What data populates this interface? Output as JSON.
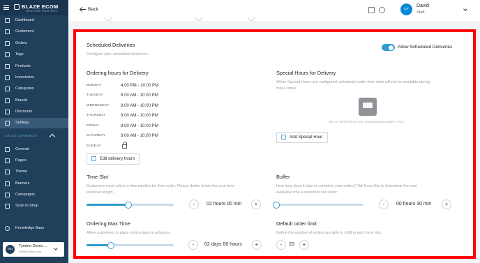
{
  "brand": {
    "name": "BLAZE ECOM",
    "tagline": "MISSION CONTROL"
  },
  "sidebar": {
    "items": [
      {
        "label": "Dashboard",
        "icon": "dashboard-icon"
      },
      {
        "label": "Customers",
        "icon": "customers-icon"
      },
      {
        "label": "Orders",
        "icon": "orders-icon"
      },
      {
        "label": "Tags",
        "icon": "tags-icon"
      },
      {
        "label": "Products",
        "icon": "products-icon"
      },
      {
        "label": "Inventories",
        "icon": "inventories-icon"
      },
      {
        "label": "Categories",
        "icon": "categories-icon"
      },
      {
        "label": "Brands",
        "icon": "brands-icon"
      },
      {
        "label": "Discounts",
        "icon": "discounts-icon"
      },
      {
        "label": "Settings",
        "icon": "settings-icon"
      }
    ],
    "section_label": "SALES CHANNELS",
    "sales_items": [
      {
        "label": "General",
        "icon": "general-icon"
      },
      {
        "label": "Pages",
        "icon": "pages-icon"
      },
      {
        "label": "Theme",
        "icon": "theme-icon"
      },
      {
        "label": "Banners",
        "icon": "banners-icon"
      },
      {
        "label": "Campaigns",
        "icon": "campaigns-icon"
      },
      {
        "label": "Scan to Shop",
        "icon": "scan-icon"
      }
    ],
    "knowledge_base": "Knowledge Base",
    "store": {
      "avatar": "TBE1",
      "name": "Tymber Demo ...",
      "subtitle": "Delivery, Pickup, Kiosk"
    }
  },
  "header": {
    "back_label": "Back",
    "user_initials": "DT",
    "user_name": "David",
    "user_role": "Staff"
  },
  "scheduled": {
    "title": "Scheduled Deliveries",
    "description": "Configure your scheduled deliveries.",
    "toggle_label": "Allow Scheduled Deliveries",
    "toggle_on": true
  },
  "ordering_hours": {
    "title": "Ordering hours for Delivery",
    "days": [
      {
        "day": "MONDAY",
        "hours": "4:00 PM - 10:00 PM"
      },
      {
        "day": "TUESDAY",
        "hours": "8:00 AM - 10:00 PM"
      },
      {
        "day": "WEDNESDAY",
        "hours": "8:00 AM - 10:00 PM"
      },
      {
        "day": "THURSDAY",
        "hours": "8:00 AM - 10:00 PM"
      },
      {
        "day": "FRIDAY",
        "hours": "8:00 AM - 10:00 PM"
      },
      {
        "day": "SATURDAY",
        "hours": "8:00 AM - 10:00 PM"
      },
      {
        "day": "SUNDAY",
        "hours": ""
      }
    ],
    "edit_button": "Edit delivery hours"
  },
  "special_hours": {
    "title": "Special Hours for Delivery",
    "description_line1": "When Special Hours are configured, scheduled order time slots will not be available during",
    "description_line2": "those times.",
    "empty_text": "NO STORE/SPECIAL-HOURS/DELIVERY YET.",
    "add_button": "Add Special Hour"
  },
  "time_slot": {
    "title": "Time Slot",
    "description_line1": "Customers must select a time window for their order. Please define below the your time",
    "description_line2": "windows length.",
    "value": "02 hours 00 min",
    "slider_fraction": 0.48
  },
  "buffer": {
    "title": "Buffer",
    "description_line1": "How long does it take to complete your orders? We'll use this to determine the next",
    "description_line2": "available time a customer can order.",
    "value": "00 hours 30 min",
    "slider_fraction": 0.0
  },
  "order_max_time": {
    "title": "Ordering Max Time",
    "description": "Allow customers to place orders days in advance.",
    "value": "02 days 00 hours",
    "slider_fraction": 0.28
  },
  "default_limit": {
    "title": "Default order limit",
    "description": "Define the number of orders are able to fulfill in each time slot.",
    "value": "20"
  }
}
